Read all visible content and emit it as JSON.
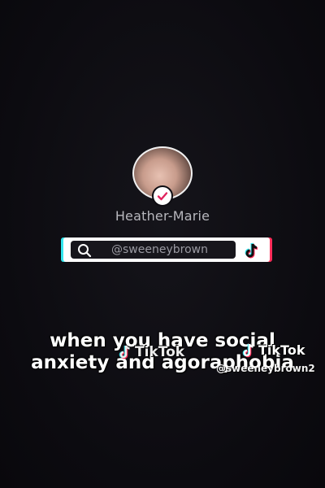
{
  "profile": {
    "name": "Heather-Marie",
    "verified": true
  },
  "search": {
    "handle": "@sweeneybrown"
  },
  "caption": {
    "line1": "when you have social",
    "line2": "anxiety and agoraphobia"
  },
  "watermark": {
    "brand": "TikTok",
    "handle": "@sweeneybrown2"
  },
  "colors": {
    "background": "#0e0d12",
    "tiktok_cyan": "#33e6ee",
    "tiktok_red": "#ff2d5a",
    "verified_check": "#e0245e"
  },
  "icons": {
    "search": "search-icon",
    "logo": "tiktok-logo-icon",
    "badge": "verified-check-icon"
  }
}
